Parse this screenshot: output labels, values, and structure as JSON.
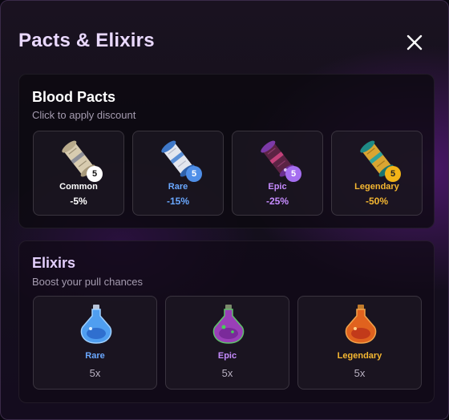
{
  "modal": {
    "title": "Pacts & Elixirs"
  },
  "blood_pacts": {
    "title": "Blood Pacts",
    "subtitle": "Click to apply discount",
    "items": [
      {
        "rarity": "Common",
        "count": "5",
        "discount": "-5%",
        "color": "#ffffff",
        "badge_bg": "#ffffff",
        "badge_fg": "#111111"
      },
      {
        "rarity": "Rare",
        "count": "5",
        "discount": "-15%",
        "color": "#6aa8ff",
        "badge_bg": "#4f8fe8",
        "badge_fg": "#ffffff"
      },
      {
        "rarity": "Epic",
        "count": "5",
        "discount": "-25%",
        "color": "#c68cff",
        "badge_bg": "#a56ef0",
        "badge_fg": "#ffffff"
      },
      {
        "rarity": "Legendary",
        "count": "5",
        "discount": "-50%",
        "color": "#f5b731",
        "badge_bg": "#f2b418",
        "badge_fg": "#222222"
      }
    ]
  },
  "elixirs": {
    "title": "Elixirs",
    "subtitle": "Boost your pull chances",
    "items": [
      {
        "rarity": "Rare",
        "quantity": "5x",
        "color": "#6aa8ff"
      },
      {
        "rarity": "Epic",
        "quantity": "5x",
        "color": "#c68cff"
      },
      {
        "rarity": "Legendary",
        "quantity": "5x",
        "color": "#f5b731"
      }
    ]
  },
  "icons": {
    "close": "close-icon",
    "pact": "scroll-icon",
    "elixir": "potion-icon"
  }
}
